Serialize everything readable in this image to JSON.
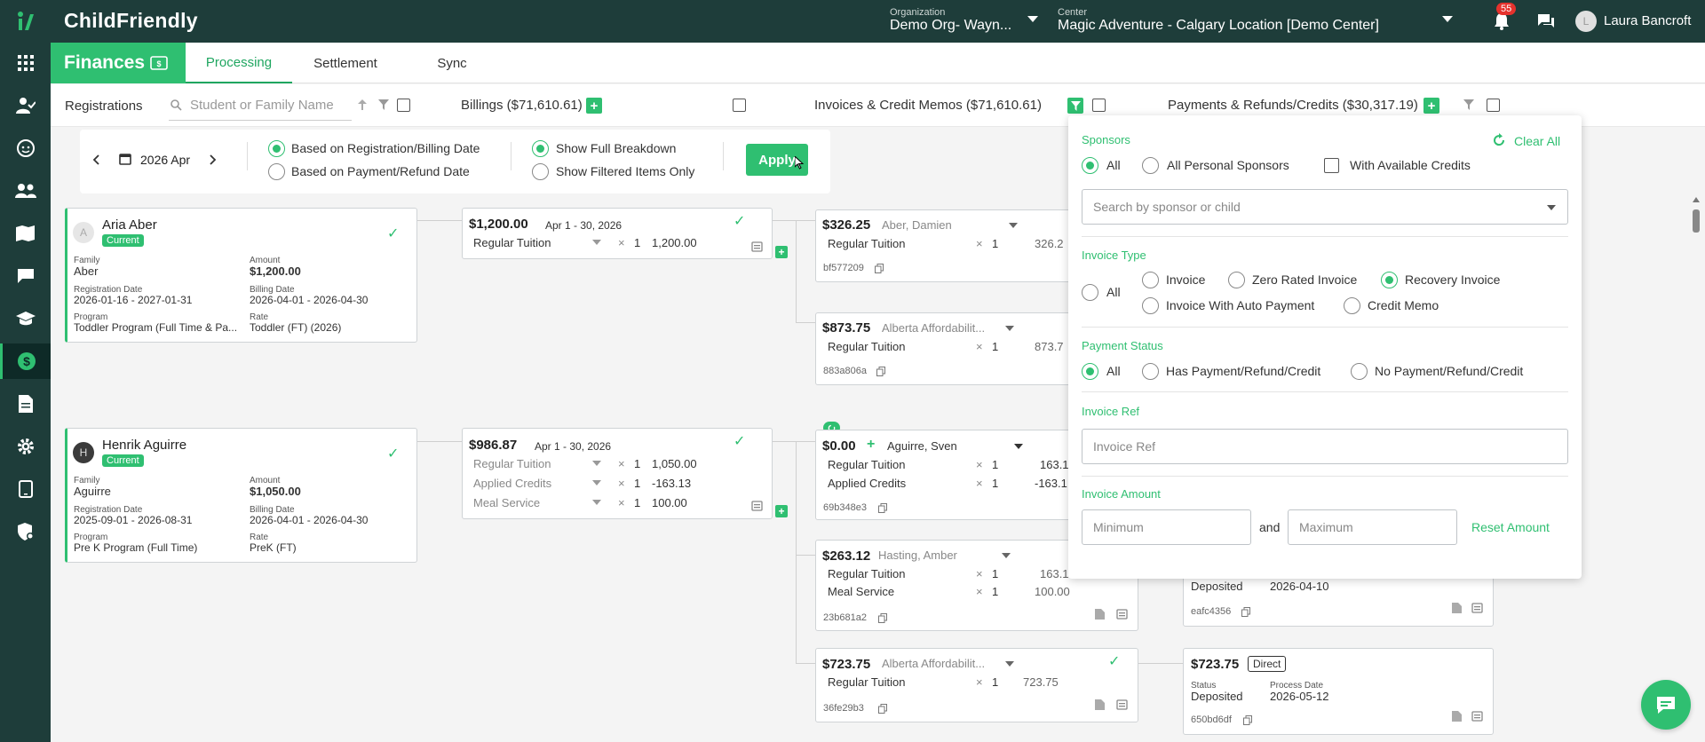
{
  "app": {
    "logo_text": "ChildFriendly",
    "brand_color": "#2fbf71",
    "dark_color": "#1e3d3a"
  },
  "topbar": {
    "org_label": "Organization",
    "org_value": "Demo Org- Wayn...",
    "center_label": "Center",
    "center_value": "Magic Adventure - Calgary Location [Demo Center]",
    "notif_count": "55",
    "user_initial": "L",
    "user_name": "Laura Bancroft"
  },
  "sidebar": {
    "icons": [
      "apps-icon",
      "user-check-icon",
      "child-face-icon",
      "family-icon",
      "map-book-icon",
      "chat-icon",
      "graduation-cap-icon",
      "dollar-icon",
      "document-icon",
      "settings-gear-icon",
      "tablet-icon",
      "shield-gear-icon"
    ]
  },
  "subnav": {
    "section": "Finances",
    "tabs": [
      "Processing",
      "Settlement",
      "Sync"
    ]
  },
  "filters": {
    "registrations": "Registrations",
    "search_placeholder": "Student or Family Name",
    "billings": "Billings ($71,610.61)",
    "invoices": "Invoices & Credit Memos ($71,610.61)",
    "payments": "Payments & Refunds/Credits ($30,317.19)"
  },
  "options": {
    "month": "2026 Apr",
    "based_reg": "Based on Registration/Billing Date",
    "based_pay": "Based on Payment/Refund Date",
    "full": "Show Full Breakdown",
    "filtered": "Show Filtered Items Only",
    "apply": "Apply"
  },
  "registrations": [
    {
      "initial": "A",
      "name": "Aria Aber",
      "status": "Current",
      "family_label": "Family",
      "family": "Aber",
      "amount_label": "Amount",
      "amount": "$1,200.00",
      "regdate_label": "Registration Date",
      "regdate": "2026-01-16 - 2027-01-31",
      "billdate_label": "Billing Date",
      "billdate": "2026-04-01 - 2026-04-30",
      "program_label": "Program",
      "program": "Toddler Program (Full Time & Pa...",
      "rate_label": "Rate",
      "rate": "Toddler (FT) (2026)"
    },
    {
      "initial": "H",
      "name": "Henrik Aguirre",
      "status": "Current",
      "family_label": "Family",
      "family": "Aguirre",
      "amount_label": "Amount",
      "amount": "$1,050.00",
      "regdate_label": "Registration Date",
      "regdate": "2025-09-01 - 2026-08-31",
      "billdate_label": "Billing Date",
      "billdate": "2026-04-01 - 2026-04-30",
      "program_label": "Program",
      "program": "Pre K Program (Full Time)",
      "rate_label": "Rate",
      "rate": "PreK (FT)"
    }
  ],
  "billings": [
    {
      "amount": "$1,200.00",
      "period": "Apr 1 - 30, 2026",
      "lines": [
        {
          "item": "Regular Tuition",
          "qty": "1",
          "value": "1,200.00"
        }
      ]
    },
    {
      "amount": "$986.87",
      "period": "Apr 1 - 30, 2026",
      "lines": [
        {
          "item": "Regular Tuition",
          "qty": "1",
          "value": "1,050.00"
        },
        {
          "item": "Applied Credits",
          "qty": "1",
          "value": "-163.13"
        },
        {
          "item": "Meal Service",
          "qty": "1",
          "value": "100.00"
        }
      ]
    }
  ],
  "invoices": [
    {
      "amount": "$326.25",
      "sponsor": "Aber, Damien",
      "lines": [
        {
          "item": "Regular Tuition",
          "qty": "1",
          "value": "326.2"
        }
      ],
      "ref": "bf577209"
    },
    {
      "amount": "$873.75",
      "sponsor": "Alberta Affordabilit...",
      "lines": [
        {
          "item": "Regular Tuition",
          "qty": "1",
          "value": "873.7"
        }
      ],
      "ref": "883a806a"
    },
    {
      "amount": "$0.00",
      "sponsor": "Aguirre, Sven",
      "lines": [
        {
          "item": "Regular Tuition",
          "qty": "1",
          "value": "163.1"
        },
        {
          "item": "Applied Credits",
          "qty": "1",
          "value": "-163.1"
        }
      ],
      "ref": "69b348e3"
    },
    {
      "amount": "$263.12",
      "sponsor": "Hasting, Amber",
      "lines": [
        {
          "item": "Regular Tuition",
          "qty": "1",
          "value": "163.1"
        },
        {
          "item": "Meal Service",
          "qty": "1",
          "value": "100.00"
        }
      ],
      "ref": "23b681a2"
    },
    {
      "amount": "$723.75",
      "sponsor": "Alberta Affordabilit...",
      "lines": [
        {
          "item": "Regular Tuition",
          "qty": "1",
          "value": "723.75"
        }
      ],
      "ref": "36fe29b3"
    }
  ],
  "payments": [
    {
      "status": "Deposited",
      "date": "2026-04-10",
      "ref": "eafc4356"
    },
    {
      "amount": "$723.75",
      "tag": "Direct",
      "status_label": "Status",
      "status": "Deposited",
      "date_label": "Process Date",
      "date": "2026-05-12",
      "ref": "650bd6df"
    }
  ],
  "popover": {
    "sponsors_title": "Sponsors",
    "clear_all": "Clear All",
    "sp_all": "All",
    "sp_personal": "All Personal Sponsors",
    "sp_credits": "With Available Credits",
    "search_placeholder": "Search by sponsor or child",
    "type_title": "Invoice Type",
    "t_all": "All",
    "t_invoice": "Invoice",
    "t_zero": "Zero Rated Invoice",
    "t_recovery": "Recovery Invoice",
    "t_auto": "Invoice With Auto Payment",
    "t_credit": "Credit Memo",
    "pay_title": "Payment Status",
    "p_all": "All",
    "p_has": "Has Payment/Refund/Credit",
    "p_no": "No Payment/Refund/Credit",
    "ref_title": "Invoice Ref",
    "ref_placeholder": "Invoice Ref",
    "amt_title": "Invoice Amount",
    "min_placeholder": "Minimum",
    "and": "and",
    "max_placeholder": "Maximum",
    "reset": "Reset Amount"
  },
  "multiply": "×"
}
